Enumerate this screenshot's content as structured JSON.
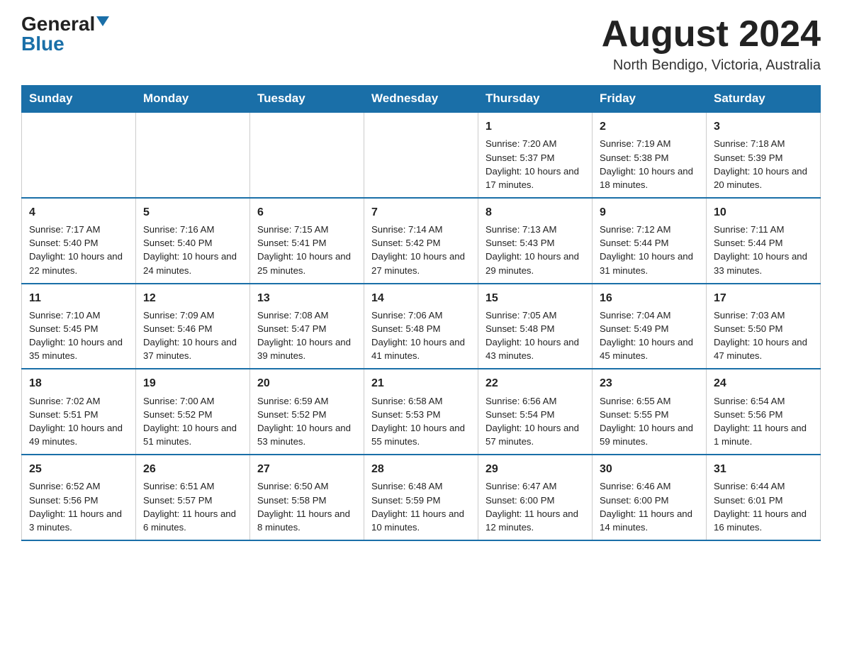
{
  "header": {
    "logo_general": "General",
    "logo_blue": "Blue",
    "month_title": "August 2024",
    "location": "North Bendigo, Victoria, Australia"
  },
  "days_of_week": [
    "Sunday",
    "Monday",
    "Tuesday",
    "Wednesday",
    "Thursday",
    "Friday",
    "Saturday"
  ],
  "weeks": [
    [
      {
        "day": "",
        "info": ""
      },
      {
        "day": "",
        "info": ""
      },
      {
        "day": "",
        "info": ""
      },
      {
        "day": "",
        "info": ""
      },
      {
        "day": "1",
        "info": "Sunrise: 7:20 AM\nSunset: 5:37 PM\nDaylight: 10 hours and 17 minutes."
      },
      {
        "day": "2",
        "info": "Sunrise: 7:19 AM\nSunset: 5:38 PM\nDaylight: 10 hours and 18 minutes."
      },
      {
        "day": "3",
        "info": "Sunrise: 7:18 AM\nSunset: 5:39 PM\nDaylight: 10 hours and 20 minutes."
      }
    ],
    [
      {
        "day": "4",
        "info": "Sunrise: 7:17 AM\nSunset: 5:40 PM\nDaylight: 10 hours and 22 minutes."
      },
      {
        "day": "5",
        "info": "Sunrise: 7:16 AM\nSunset: 5:40 PM\nDaylight: 10 hours and 24 minutes."
      },
      {
        "day": "6",
        "info": "Sunrise: 7:15 AM\nSunset: 5:41 PM\nDaylight: 10 hours and 25 minutes."
      },
      {
        "day": "7",
        "info": "Sunrise: 7:14 AM\nSunset: 5:42 PM\nDaylight: 10 hours and 27 minutes."
      },
      {
        "day": "8",
        "info": "Sunrise: 7:13 AM\nSunset: 5:43 PM\nDaylight: 10 hours and 29 minutes."
      },
      {
        "day": "9",
        "info": "Sunrise: 7:12 AM\nSunset: 5:44 PM\nDaylight: 10 hours and 31 minutes."
      },
      {
        "day": "10",
        "info": "Sunrise: 7:11 AM\nSunset: 5:44 PM\nDaylight: 10 hours and 33 minutes."
      }
    ],
    [
      {
        "day": "11",
        "info": "Sunrise: 7:10 AM\nSunset: 5:45 PM\nDaylight: 10 hours and 35 minutes."
      },
      {
        "day": "12",
        "info": "Sunrise: 7:09 AM\nSunset: 5:46 PM\nDaylight: 10 hours and 37 minutes."
      },
      {
        "day": "13",
        "info": "Sunrise: 7:08 AM\nSunset: 5:47 PM\nDaylight: 10 hours and 39 minutes."
      },
      {
        "day": "14",
        "info": "Sunrise: 7:06 AM\nSunset: 5:48 PM\nDaylight: 10 hours and 41 minutes."
      },
      {
        "day": "15",
        "info": "Sunrise: 7:05 AM\nSunset: 5:48 PM\nDaylight: 10 hours and 43 minutes."
      },
      {
        "day": "16",
        "info": "Sunrise: 7:04 AM\nSunset: 5:49 PM\nDaylight: 10 hours and 45 minutes."
      },
      {
        "day": "17",
        "info": "Sunrise: 7:03 AM\nSunset: 5:50 PM\nDaylight: 10 hours and 47 minutes."
      }
    ],
    [
      {
        "day": "18",
        "info": "Sunrise: 7:02 AM\nSunset: 5:51 PM\nDaylight: 10 hours and 49 minutes."
      },
      {
        "day": "19",
        "info": "Sunrise: 7:00 AM\nSunset: 5:52 PM\nDaylight: 10 hours and 51 minutes."
      },
      {
        "day": "20",
        "info": "Sunrise: 6:59 AM\nSunset: 5:52 PM\nDaylight: 10 hours and 53 minutes."
      },
      {
        "day": "21",
        "info": "Sunrise: 6:58 AM\nSunset: 5:53 PM\nDaylight: 10 hours and 55 minutes."
      },
      {
        "day": "22",
        "info": "Sunrise: 6:56 AM\nSunset: 5:54 PM\nDaylight: 10 hours and 57 minutes."
      },
      {
        "day": "23",
        "info": "Sunrise: 6:55 AM\nSunset: 5:55 PM\nDaylight: 10 hours and 59 minutes."
      },
      {
        "day": "24",
        "info": "Sunrise: 6:54 AM\nSunset: 5:56 PM\nDaylight: 11 hours and 1 minute."
      }
    ],
    [
      {
        "day": "25",
        "info": "Sunrise: 6:52 AM\nSunset: 5:56 PM\nDaylight: 11 hours and 3 minutes."
      },
      {
        "day": "26",
        "info": "Sunrise: 6:51 AM\nSunset: 5:57 PM\nDaylight: 11 hours and 6 minutes."
      },
      {
        "day": "27",
        "info": "Sunrise: 6:50 AM\nSunset: 5:58 PM\nDaylight: 11 hours and 8 minutes."
      },
      {
        "day": "28",
        "info": "Sunrise: 6:48 AM\nSunset: 5:59 PM\nDaylight: 11 hours and 10 minutes."
      },
      {
        "day": "29",
        "info": "Sunrise: 6:47 AM\nSunset: 6:00 PM\nDaylight: 11 hours and 12 minutes."
      },
      {
        "day": "30",
        "info": "Sunrise: 6:46 AM\nSunset: 6:00 PM\nDaylight: 11 hours and 14 minutes."
      },
      {
        "day": "31",
        "info": "Sunrise: 6:44 AM\nSunset: 6:01 PM\nDaylight: 11 hours and 16 minutes."
      }
    ]
  ]
}
